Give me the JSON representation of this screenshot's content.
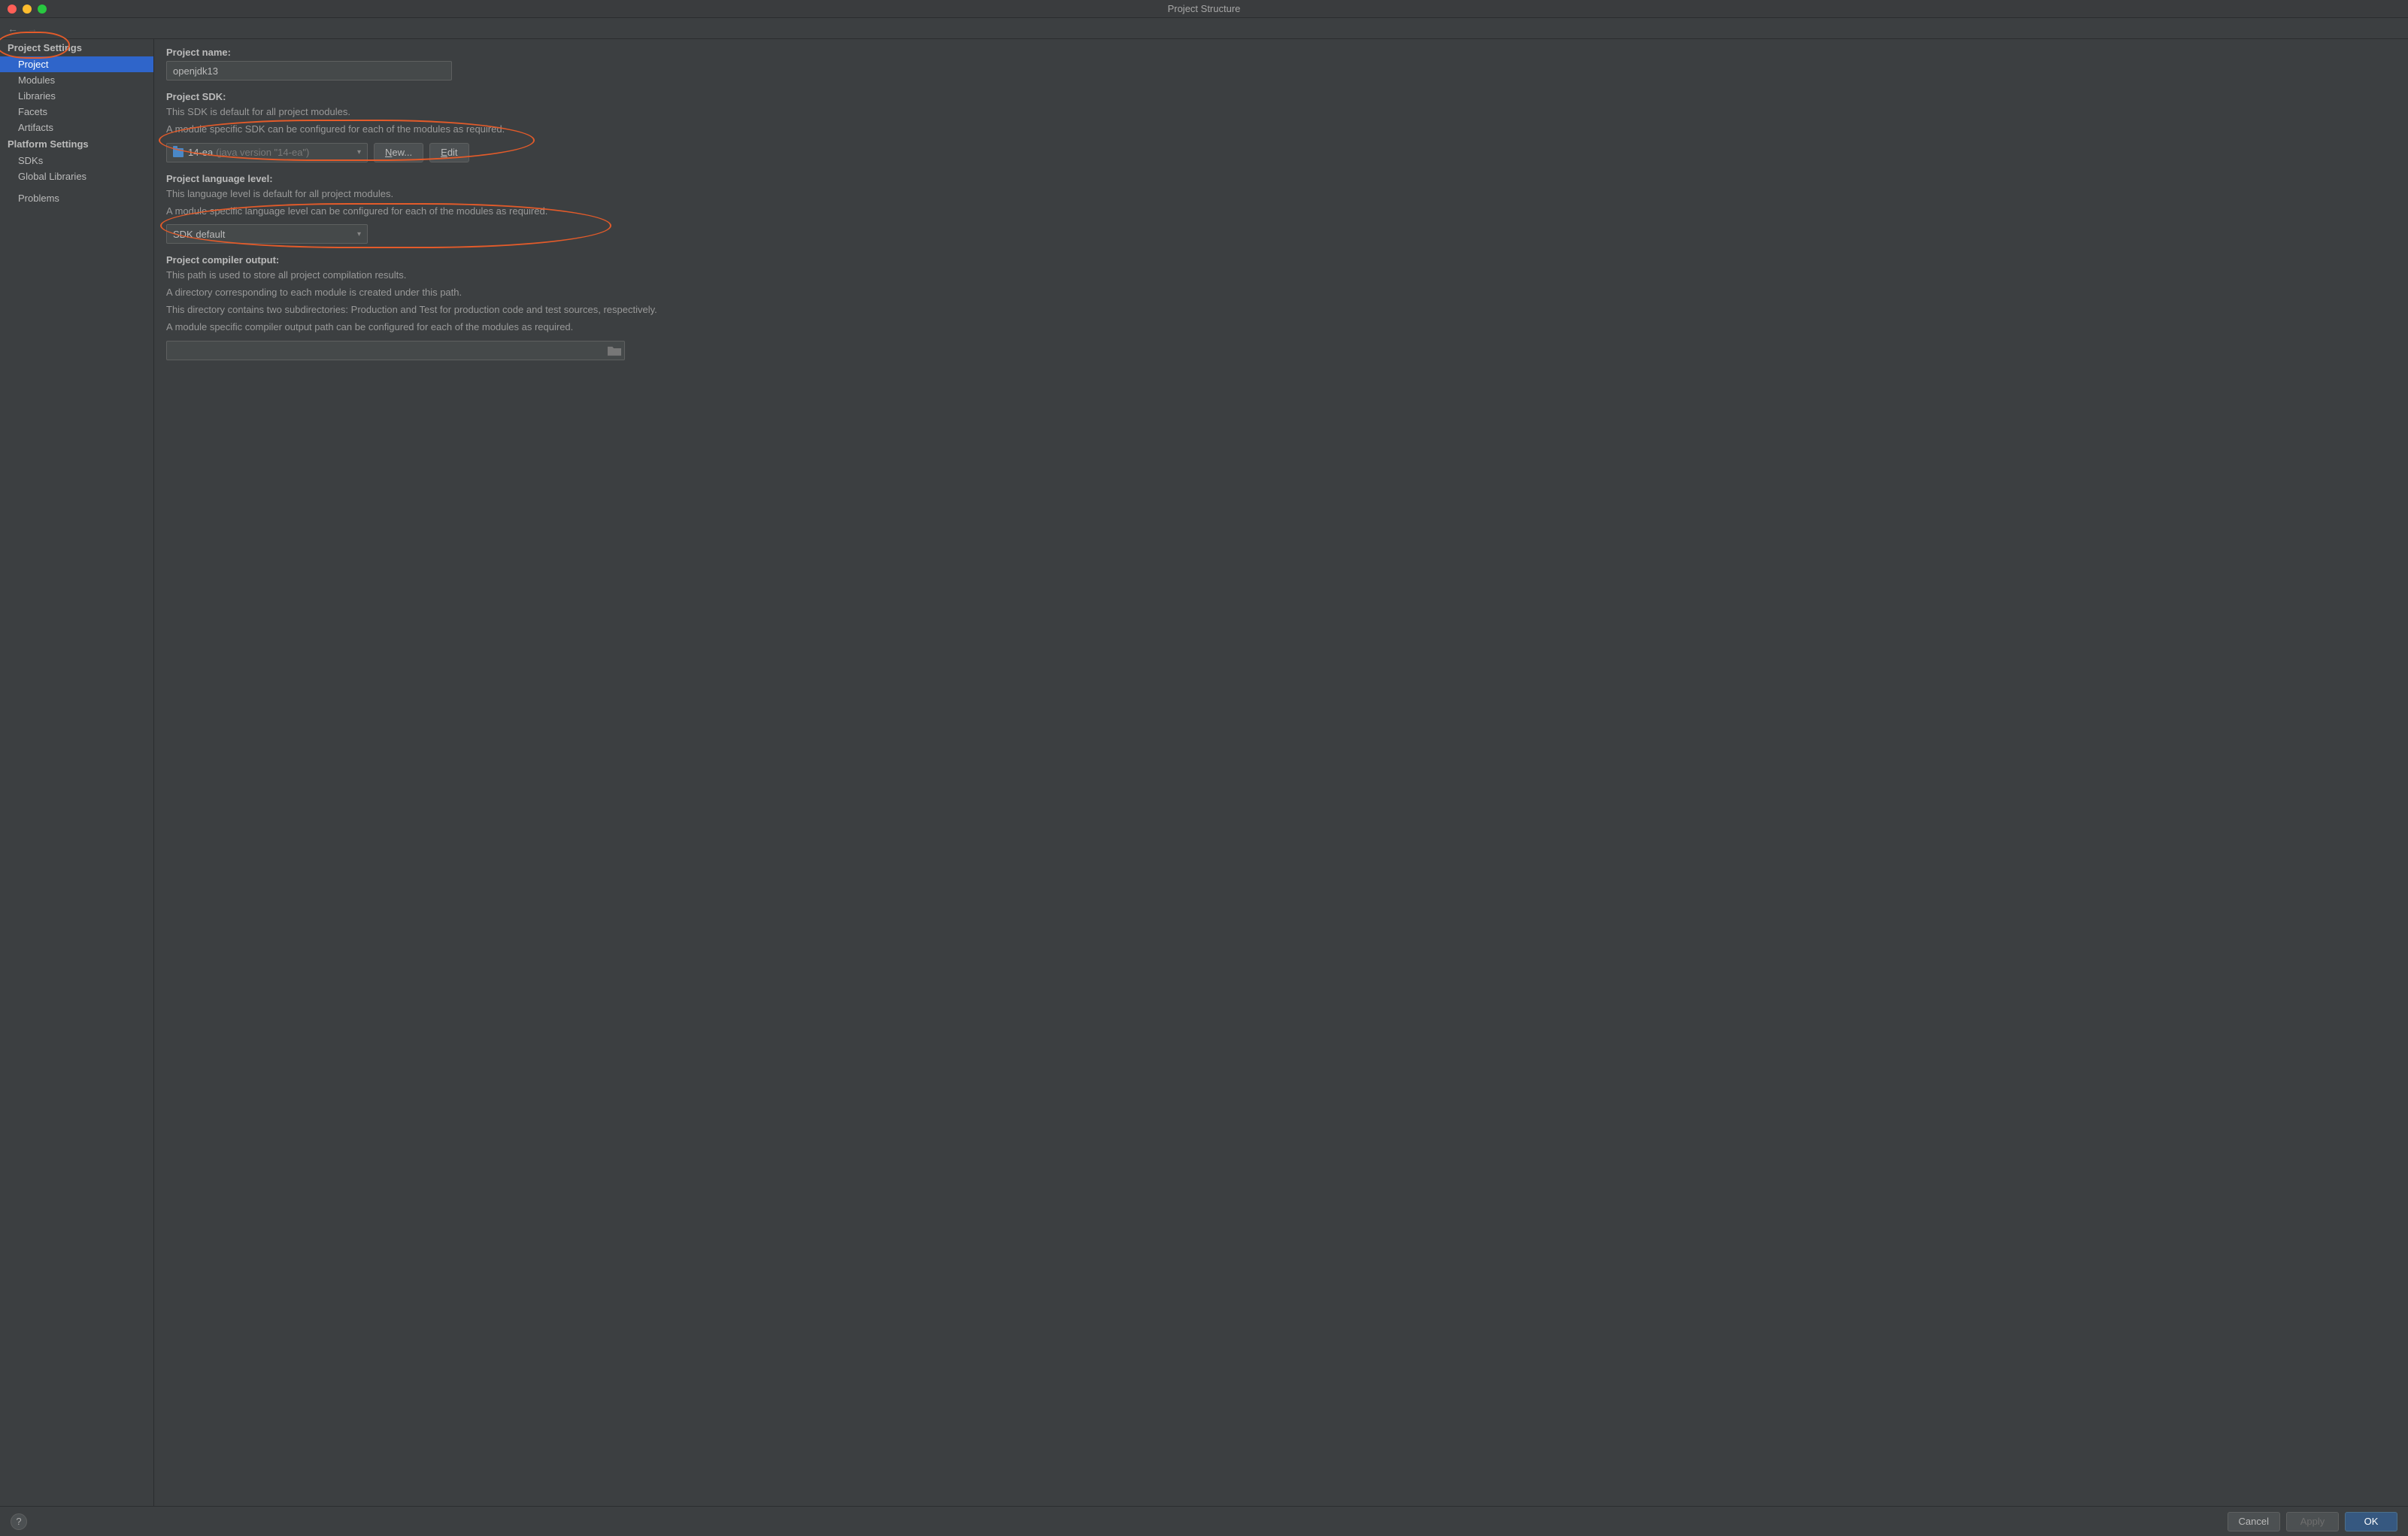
{
  "window": {
    "title": "Project Structure"
  },
  "sidebar": {
    "headings": {
      "project_settings": "Project Settings",
      "platform_settings": "Platform Settings"
    },
    "project_settings": {
      "project": {
        "label": "Project"
      },
      "modules": {
        "label": "Modules"
      },
      "libraries": {
        "label": "Libraries"
      },
      "facets": {
        "label": "Facets"
      },
      "artifacts": {
        "label": "Artifacts"
      }
    },
    "platform_settings": {
      "sdks": {
        "label": "SDKs"
      },
      "global_libraries": {
        "label": "Global Libraries"
      }
    },
    "problems": {
      "label": "Problems"
    }
  },
  "content": {
    "project_name": {
      "label": "Project name:",
      "value": "openjdk13"
    },
    "project_sdk": {
      "label": "Project SDK:",
      "desc_line1": "This SDK is default for all project modules.",
      "desc_line2": "A module specific SDK can be configured for each of the modules as required.",
      "selected": "14-ea",
      "selected_suffix": "(java version \"14-ea\")",
      "new_button": "New...",
      "new_accel": "N",
      "edit_button": "Edit",
      "edit_accel": "E"
    },
    "language_level": {
      "label": "Project language level:",
      "desc_line1": "This language level is default for all project modules.",
      "desc_line2": "A module specific language level can be configured for each of the modules as required.",
      "selected": "SDK default"
    },
    "compiler_output": {
      "label": "Project compiler output:",
      "desc_line1": "This path is used to store all project compilation results.",
      "desc_line2": "A directory corresponding to each module is created under this path.",
      "desc_line3": "This directory contains two subdirectories: Production and Test for production code and test sources, respectively.",
      "desc_line4": "A module specific compiler output path can be configured for each of the modules as required.",
      "value": ""
    }
  },
  "footer": {
    "cancel": "Cancel",
    "apply": "Apply",
    "ok": "OK"
  }
}
